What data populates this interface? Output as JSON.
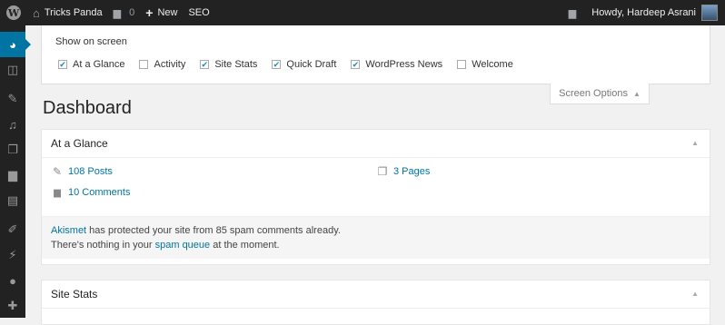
{
  "adminbar": {
    "wp_logo": "W",
    "site_name": "Tricks Panda",
    "comments_count": "0",
    "new_label": "New",
    "seo_label": "SEO",
    "greeting": "Howdy, Hardeep Asrani"
  },
  "menu_icons": [
    "dashboard-icon",
    "jetpack-icon",
    "posts-icon",
    "media-icon",
    "pages-icon",
    "comments-icon",
    "forms-icon",
    "appearance-icon",
    "plugins-icon",
    "users-icon",
    "tools-icon"
  ],
  "screen_options": {
    "title": "Show on screen",
    "options": [
      {
        "label": "At a Glance",
        "checked": true
      },
      {
        "label": "Activity",
        "checked": false
      },
      {
        "label": "Site Stats",
        "checked": true
      },
      {
        "label": "Quick Draft",
        "checked": true
      },
      {
        "label": "WordPress News",
        "checked": true
      },
      {
        "label": "Welcome",
        "checked": false
      }
    ],
    "tab_label": "Screen Options"
  },
  "page_title": "Dashboard",
  "at_a_glance": {
    "title": "At a Glance",
    "posts": "108 Posts",
    "pages": "3 Pages",
    "comments": "10 Comments",
    "akismet_link": "Akismet",
    "akismet_text": " has protected your site from 85 spam comments already.",
    "queue_prefix": "There's nothing in your ",
    "queue_link": "spam queue",
    "queue_suffix": " at the moment."
  },
  "site_stats": {
    "title": "Site Stats"
  }
}
